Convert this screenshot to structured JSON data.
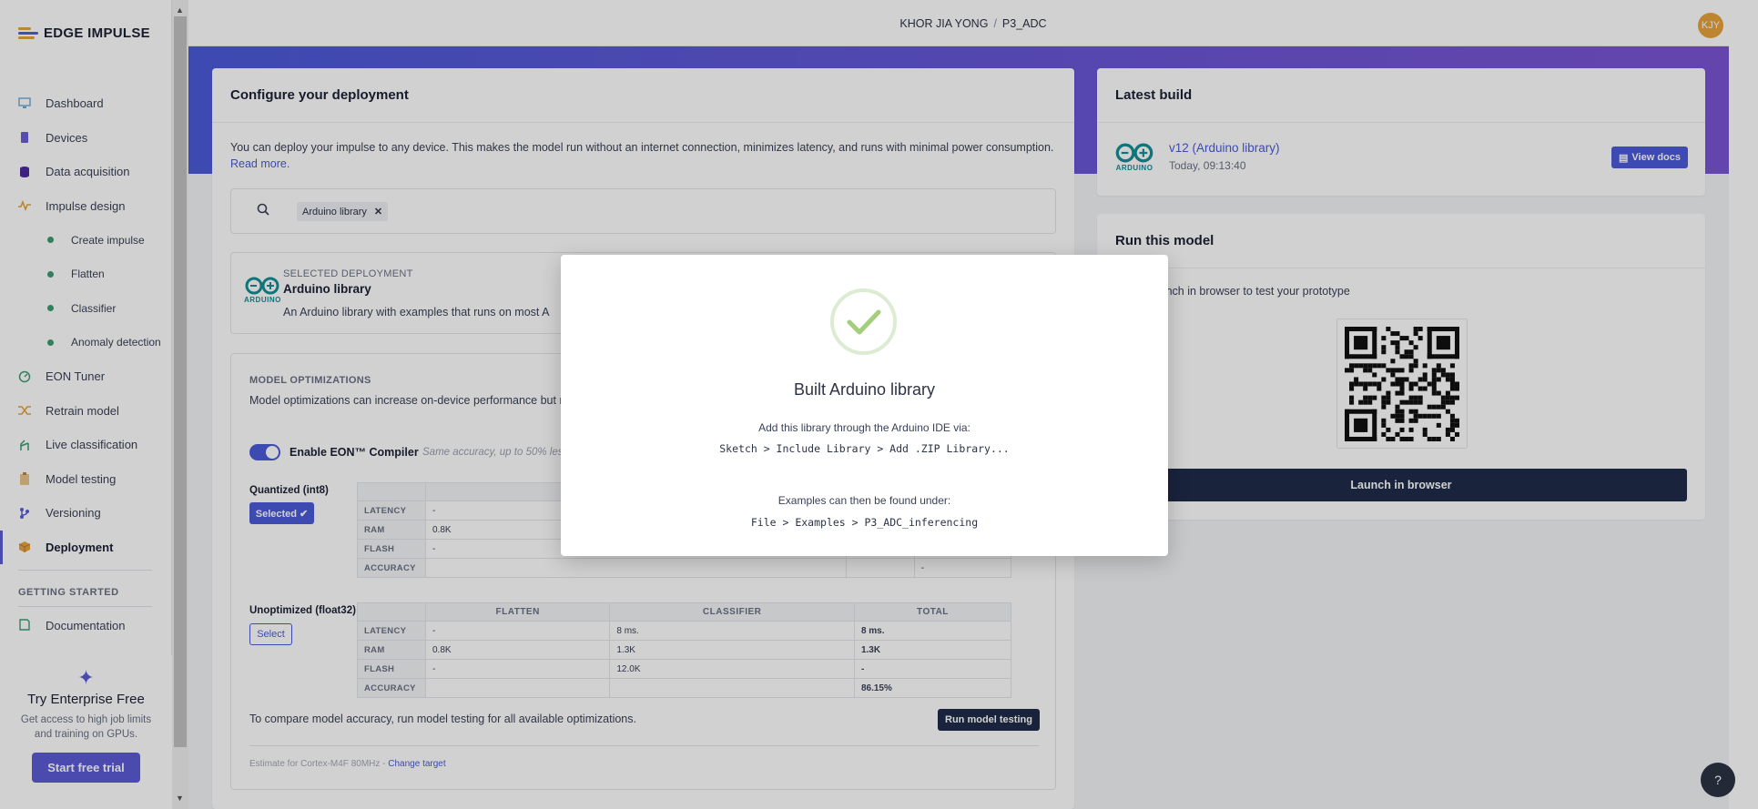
{
  "brand": {
    "name": "EDGE IMPULSE"
  },
  "header": {
    "user": "KHOR JIA YONG",
    "separator": "/",
    "project": "P3_ADC",
    "avatar_initials": "KJY"
  },
  "sidebar": {
    "items": [
      {
        "label": "Dashboard",
        "icon": "monitor-icon"
      },
      {
        "label": "Devices",
        "icon": "chip-icon"
      },
      {
        "label": "Data acquisition",
        "icon": "database-icon"
      },
      {
        "label": "Impulse design",
        "icon": "pulse-icon"
      },
      {
        "label": "Create impulse",
        "icon": "dot-icon"
      },
      {
        "label": "Flatten",
        "icon": "dot-icon"
      },
      {
        "label": "Classifier",
        "icon": "dot-icon"
      },
      {
        "label": "Anomaly detection",
        "icon": "dot-icon"
      },
      {
        "label": "EON Tuner",
        "icon": "tuner-icon"
      },
      {
        "label": "Retrain model",
        "icon": "shuffle-icon"
      },
      {
        "label": "Live classification",
        "icon": "branch-icon"
      },
      {
        "label": "Model testing",
        "icon": "clipboard-icon"
      },
      {
        "label": "Versioning",
        "icon": "version-icon"
      },
      {
        "label": "Deployment",
        "icon": "box-icon"
      }
    ],
    "getting_started": "GETTING STARTED",
    "documentation": "Documentation"
  },
  "promo": {
    "title": "Try Enterprise Free",
    "text": "Get access to high job limits and training on GPUs.",
    "button": "Start free trial"
  },
  "configure": {
    "title": "Configure your deployment",
    "description": "You can deploy your impulse to any device. This makes the model run without an internet connection, minimizes latency, and runs with minimal power consumption.",
    "read_more": "Read more.",
    "search_chip": "Arduino library",
    "selected_label": "SELECTED DEPLOYMENT",
    "selected_name": "Arduino library",
    "selected_desc": "An Arduino library with examples that runs on most A",
    "optimizations_title": "MODEL OPTIMIZATIONS",
    "optimizations_desc": "Model optimizations can increase on-device performance but m",
    "eon_label": "Enable EON™ Compiler",
    "eon_note": "Same accuracy, up to 50% less",
    "quantized": {
      "label": "Quantized (int8)",
      "button": "Selected ✔",
      "columns": [
        "",
        "FLATTEN",
        "",
        ""
      ],
      "rows": [
        {
          "label": "LATENCY",
          "cells": [
            "-",
            "",
            ""
          ]
        },
        {
          "label": "RAM",
          "cells": [
            "0.8K",
            "",
            ""
          ]
        },
        {
          "label": "FLASH",
          "cells": [
            "-",
            "",
            ""
          ]
        },
        {
          "label": "ACCURACY",
          "cells": [
            "",
            "",
            "-"
          ]
        }
      ]
    },
    "unoptimized": {
      "label": "Unoptimized (float32)",
      "button": "Select",
      "columns": [
        "",
        "FLATTEN",
        "CLASSIFIER",
        "TOTAL"
      ],
      "rows": [
        {
          "label": "LATENCY",
          "cells": [
            "-",
            "8 ms.",
            "8 ms."
          ]
        },
        {
          "label": "RAM",
          "cells": [
            "0.8K",
            "1.3K",
            "1.3K"
          ]
        },
        {
          "label": "FLASH",
          "cells": [
            "-",
            "12.0K",
            "-"
          ]
        },
        {
          "label": "ACCURACY",
          "cells": [
            "",
            "",
            "86.15%"
          ]
        }
      ]
    },
    "compare_text": "To compare model accuracy, run model testing for all available optimizations.",
    "run_testing": "Run model testing",
    "estimate": "Estimate for Cortex-M4F 80MHz -",
    "change_target": "Change target"
  },
  "latest_build": {
    "title": "Latest build",
    "name": "v12 (Arduino library)",
    "time": "Today, 09:13:40",
    "view_docs": "View docs"
  },
  "run_model": {
    "title": "Run this model",
    "text": "ode or launch in browser to test your prototype",
    "launch": "Launch in browser"
  },
  "modal": {
    "title": "Built Arduino library",
    "line1": "Add this library through the Arduino IDE via:",
    "code1": "Sketch > Include Library > Add .ZIP Library...",
    "line2": "Examples can then be found under:",
    "code2": "File > Examples > P3_ADC_inferencing"
  },
  "colors": {
    "accent": "#4b5bd8",
    "dark": "#1f2b4a",
    "success": "#3d9c73",
    "brand": "#e8a33c"
  }
}
